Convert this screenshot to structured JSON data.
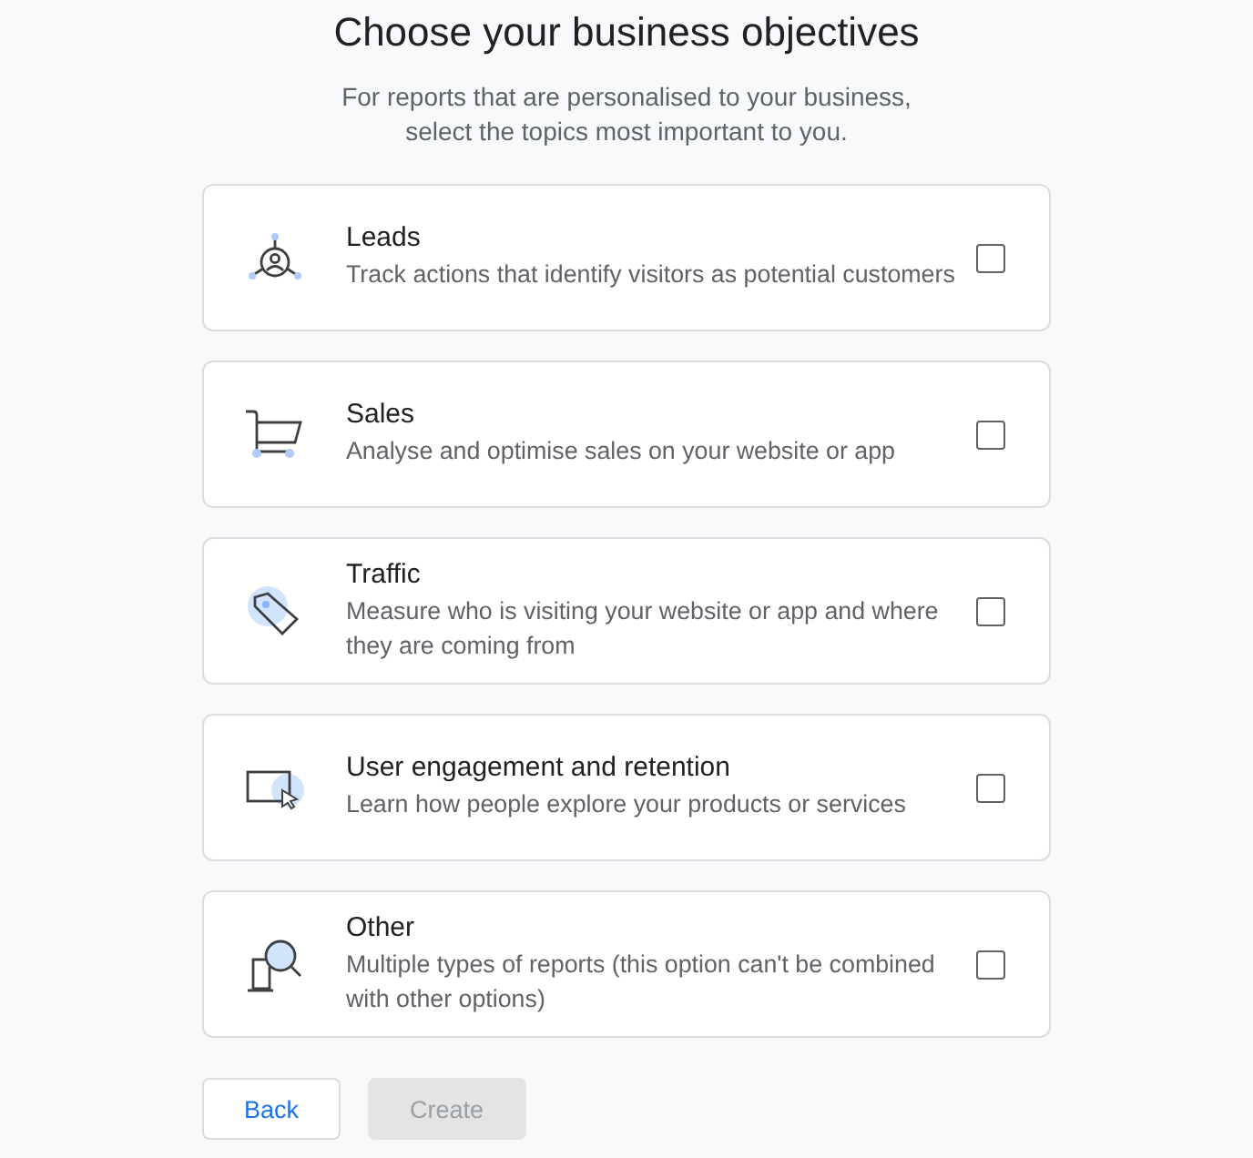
{
  "title": "Choose your business objectives",
  "subtitle": [
    "For reports that are personalised to your business,",
    "select the topics most important to you."
  ],
  "objectives": [
    {
      "kind": "leads",
      "title": "Leads",
      "description": "Track actions that identify visitors as potential customers",
      "checked": false
    },
    {
      "kind": "sales",
      "title": "Sales",
      "description": "Analyse and optimise sales on your website or app",
      "checked": false
    },
    {
      "kind": "traffic",
      "title": "Traffic",
      "description": "Measure who is visiting your website or app and where they are coming from",
      "checked": false
    },
    {
      "kind": "engagement",
      "title": "User engagement and retention",
      "description": "Learn how people explore your products or services",
      "checked": false
    },
    {
      "kind": "other",
      "title": "Other",
      "description": "Multiple types of reports (this option can't be combined with other options)",
      "checked": false
    }
  ],
  "buttons": [
    {
      "label": "Back",
      "disabled": false
    },
    {
      "label": "Create",
      "disabled": true
    }
  ]
}
